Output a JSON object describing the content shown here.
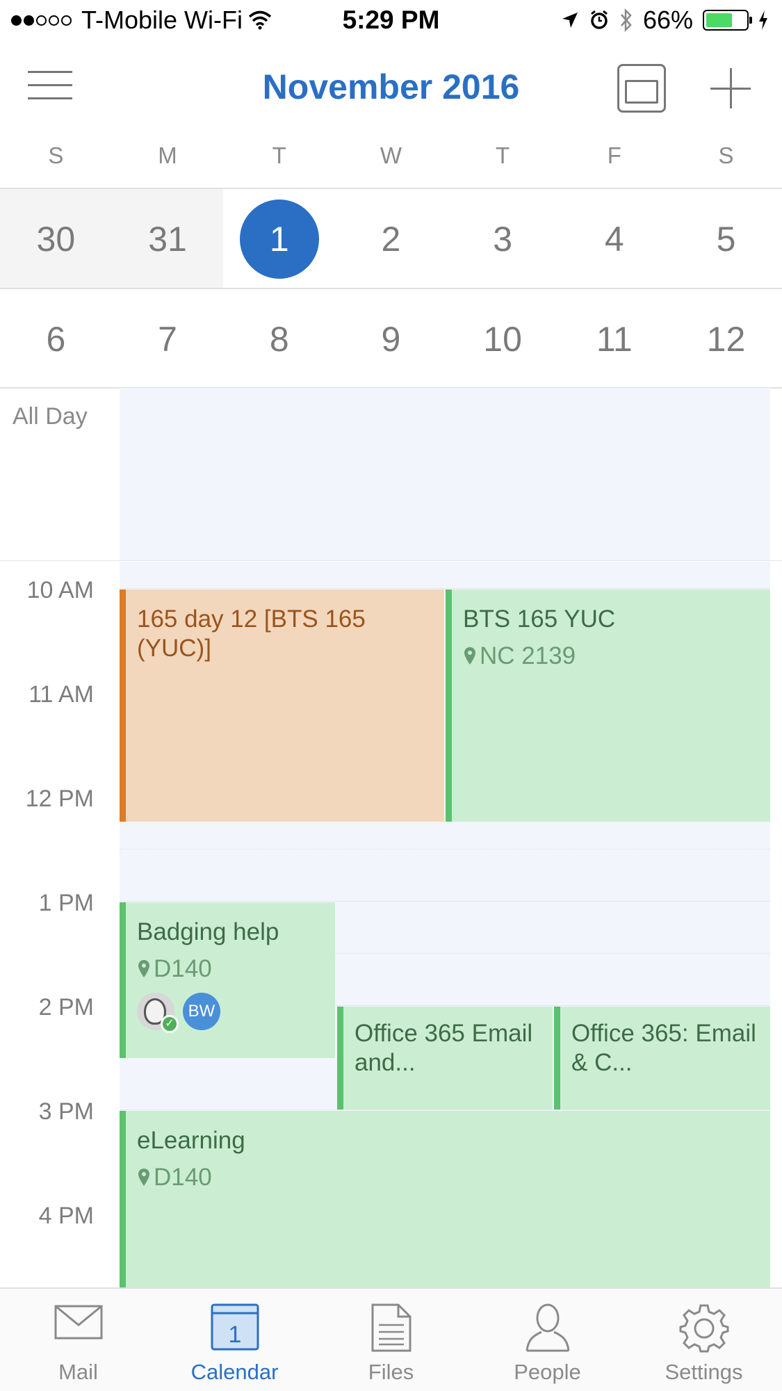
{
  "status_bar": {
    "carrier": "T-Mobile Wi-Fi",
    "time": "5:29 PM",
    "battery": "66%"
  },
  "header": {
    "title": "November 2016"
  },
  "weekdays": [
    "S",
    "M",
    "T",
    "W",
    "T",
    "F",
    "S"
  ],
  "calendar": {
    "week1": [
      "30",
      "31",
      "1",
      "2",
      "3",
      "4",
      "5"
    ],
    "week2": [
      "6",
      "7",
      "8",
      "9",
      "10",
      "11",
      "12"
    ],
    "today": "1"
  },
  "day_view": {
    "all_day_label": "All Day",
    "hours": [
      "10 AM",
      "11 AM",
      "12 PM",
      "1 PM",
      "2 PM",
      "3 PM",
      "4 PM"
    ],
    "events": {
      "e1": {
        "title": "165 day 12 [BTS  165 (YUC)]"
      },
      "e2": {
        "title": "BTS 165 YUC",
        "location": "NC 2139"
      },
      "e3": {
        "title": "Badging help",
        "location": "D140",
        "attendee_initials": "BW"
      },
      "e4": {
        "title": "Office 365 Email and..."
      },
      "e5": {
        "title": "Office 365: Email & C..."
      },
      "e6": {
        "title": "eLearning",
        "location": "D140"
      }
    }
  },
  "tabs": {
    "mail": "Mail",
    "calendar": "Calendar",
    "calendar_icon_day": "1",
    "files": "Files",
    "people": "People",
    "settings": "Settings"
  },
  "colors": {
    "accent": "#2b6fc4",
    "event_green": "#cbeed3",
    "event_orange": "#f3d7bd"
  }
}
